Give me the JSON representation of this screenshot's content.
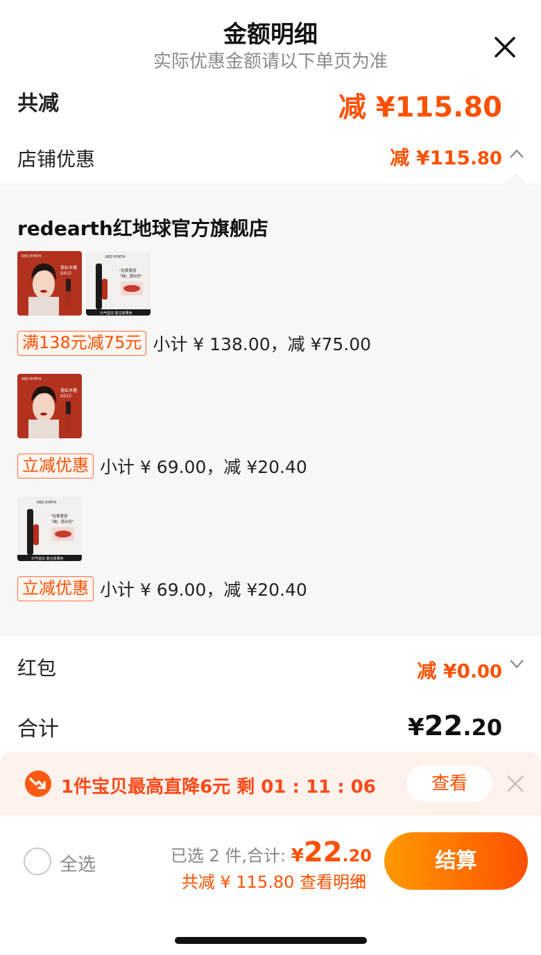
{
  "header": {
    "title": "金额明细",
    "subtitle": "实际优惠金额请以下单页为准"
  },
  "summary": {
    "total_cut_label": "共减",
    "total_cut_value": "减 ¥115.80"
  },
  "shop_discount": {
    "label": "店铺优惠",
    "prefix": "减 ¥",
    "int": "115",
    "dec": ".80"
  },
  "store": {
    "name": "redearth红地球官方旗舰店",
    "groups": [
      {
        "tag": "满138元减75元",
        "text": "小计 ¥ 138.00，减 ¥75.00"
      },
      {
        "tag": "立减优惠",
        "text": "小计 ¥ 69.00，减 ¥20.40"
      },
      {
        "tag": "立减优惠",
        "text": "小计 ¥ 69.00，减 ¥20.40"
      }
    ],
    "thumb_text": {
      "brand": "RED EYRTH",
      "shade": "霓虹木槿",
      "code": "G015",
      "slogan_1": "\"轻柔雾感",
      "slogan_2": "「釉」感出色\"",
      "caption": "元气显白 复古浆果色"
    }
  },
  "hongbao": {
    "label": "红包",
    "prefix": "减 ¥",
    "int": "0",
    "dec": ".00"
  },
  "total": {
    "label": "合计",
    "currency": "¥",
    "int": "22",
    "dec": ".20"
  },
  "deal_banner": {
    "text": "1件宝贝最高直降6元 剩 01 : 11 : 06",
    "button": "查看"
  },
  "bottom_bar": {
    "select_all": "全选",
    "selected_label": "已选 2 件,合计: ",
    "currency": "¥",
    "int": "22",
    "dec": ".20",
    "saved_text": "共减 ¥ 115.80  查看明细",
    "checkout": "结算"
  },
  "colors": {
    "accent": "#ff5000",
    "panel_bg": "#f7f7f7",
    "banner_bg": "#fff1eb"
  }
}
